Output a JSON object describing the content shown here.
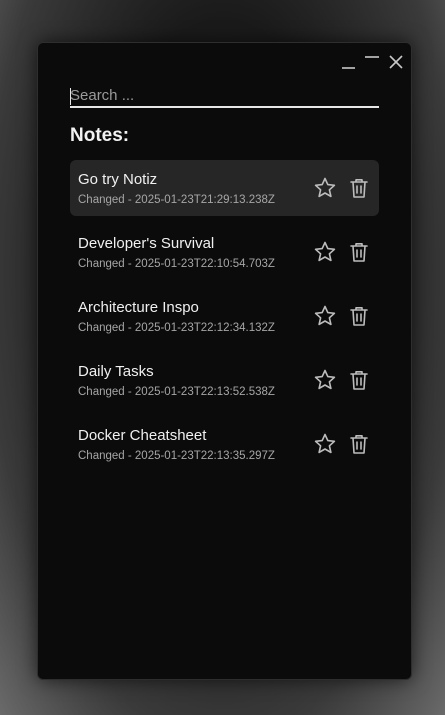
{
  "window": {
    "controls": {
      "minimize_icon": "minimize-icon",
      "maximize_icon": "maximize-icon",
      "close_icon": "close-icon"
    }
  },
  "search": {
    "placeholder": "Search ...",
    "value": ""
  },
  "notes_heading": "Notes:",
  "notes": [
    {
      "title": "Go try Notiz",
      "changed": "Changed - 2025-01-23T21:29:13.238Z",
      "active": true
    },
    {
      "title": "Developer's Survival",
      "changed": "Changed - 2025-01-23T22:10:54.703Z",
      "active": false
    },
    {
      "title": "Architecture Inspo",
      "changed": "Changed - 2025-01-23T22:12:34.132Z",
      "active": false
    },
    {
      "title": "Daily Tasks",
      "changed": "Changed - 2025-01-23T22:13:52.538Z",
      "active": false
    },
    {
      "title": "Docker Cheatsheet",
      "changed": "Changed - 2025-01-23T22:13:35.297Z",
      "active": false
    }
  ],
  "colors": {
    "window_bg": "#0b0b0b",
    "active_row_bg": "#262626",
    "text_primary": "#f0f0f0",
    "text_secondary": "#a6a6a6",
    "icon": "#bdbdbd"
  }
}
